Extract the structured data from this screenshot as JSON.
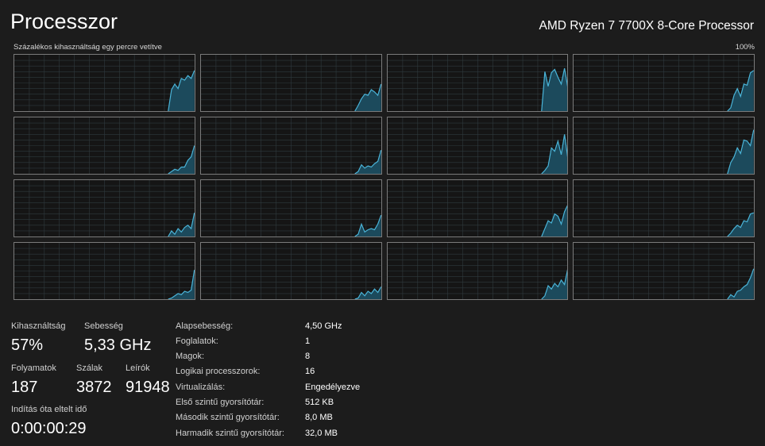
{
  "header": {
    "title": "Processzor",
    "cpu_name": "AMD Ryzen 7 7700X 8-Core Processor"
  },
  "graph": {
    "subtitle": "Százalékos kihasználtság egy percre vetítve",
    "max_label": "100%",
    "line_color": "#4ab4d8",
    "fill_color": "#1c4a5c",
    "grid_color": "#2f3a3e",
    "cores": [
      [
        0,
        0,
        0,
        0,
        0,
        0,
        0,
        0,
        0,
        0,
        0,
        0,
        0,
        0,
        0,
        0,
        0,
        0,
        0,
        0,
        0,
        0,
        0,
        0,
        0,
        0,
        0,
        0,
        0,
        0,
        0,
        0,
        0,
        0,
        0,
        0,
        0,
        0,
        0,
        0,
        0,
        0,
        0,
        0,
        0,
        0,
        0,
        0,
        38,
        48,
        40,
        58,
        55,
        63,
        58,
        72
      ],
      [
        0,
        0,
        0,
        0,
        0,
        0,
        0,
        0,
        0,
        0,
        0,
        0,
        0,
        0,
        0,
        0,
        0,
        0,
        0,
        0,
        0,
        0,
        0,
        0,
        0,
        0,
        0,
        0,
        0,
        0,
        0,
        0,
        0,
        0,
        0,
        0,
        0,
        0,
        0,
        0,
        0,
        0,
        0,
        0,
        0,
        0,
        0,
        0,
        10,
        22,
        30,
        28,
        38,
        34,
        28,
        48
      ],
      [
        0,
        0,
        0,
        0,
        0,
        0,
        0,
        0,
        0,
        0,
        0,
        0,
        0,
        0,
        0,
        0,
        0,
        0,
        0,
        0,
        0,
        0,
        0,
        0,
        0,
        0,
        0,
        0,
        0,
        0,
        0,
        0,
        0,
        0,
        0,
        0,
        0,
        0,
        0,
        0,
        0,
        0,
        0,
        0,
        0,
        0,
        0,
        0,
        70,
        44,
        68,
        74,
        60,
        48,
        76,
        42
      ],
      [
        0,
        0,
        0,
        0,
        0,
        0,
        0,
        0,
        0,
        0,
        0,
        0,
        0,
        0,
        0,
        0,
        0,
        0,
        0,
        0,
        0,
        0,
        0,
        0,
        0,
        0,
        0,
        0,
        0,
        0,
        0,
        0,
        0,
        0,
        0,
        0,
        0,
        0,
        0,
        0,
        0,
        0,
        0,
        0,
        0,
        0,
        0,
        0,
        6,
        28,
        40,
        26,
        48,
        46,
        68,
        72
      ],
      [
        0,
        0,
        0,
        0,
        0,
        0,
        0,
        0,
        0,
        0,
        0,
        0,
        0,
        0,
        0,
        0,
        0,
        0,
        0,
        0,
        0,
        0,
        0,
        0,
        0,
        0,
        0,
        0,
        0,
        0,
        0,
        0,
        0,
        0,
        0,
        0,
        0,
        0,
        0,
        0,
        0,
        0,
        0,
        0,
        0,
        0,
        0,
        0,
        4,
        8,
        6,
        12,
        12,
        24,
        30,
        50
      ],
      [
        0,
        0,
        0,
        0,
        0,
        0,
        0,
        0,
        0,
        0,
        0,
        0,
        0,
        0,
        0,
        0,
        0,
        0,
        0,
        0,
        0,
        0,
        0,
        0,
        0,
        0,
        0,
        0,
        0,
        0,
        0,
        0,
        0,
        0,
        0,
        0,
        0,
        0,
        0,
        0,
        0,
        0,
        0,
        0,
        0,
        0,
        0,
        0,
        4,
        16,
        10,
        14,
        12,
        18,
        22,
        42
      ],
      [
        0,
        0,
        0,
        0,
        0,
        0,
        0,
        0,
        0,
        0,
        0,
        0,
        0,
        0,
        0,
        0,
        0,
        0,
        0,
        0,
        0,
        0,
        0,
        0,
        0,
        0,
        0,
        0,
        0,
        0,
        0,
        0,
        0,
        0,
        0,
        0,
        0,
        0,
        0,
        0,
        0,
        0,
        0,
        0,
        0,
        0,
        0,
        0,
        6,
        14,
        46,
        40,
        58,
        34,
        70,
        28
      ],
      [
        0,
        0,
        0,
        0,
        0,
        0,
        0,
        0,
        0,
        0,
        0,
        0,
        0,
        0,
        0,
        0,
        0,
        0,
        0,
        0,
        0,
        0,
        0,
        0,
        0,
        0,
        0,
        0,
        0,
        0,
        0,
        0,
        0,
        0,
        0,
        0,
        0,
        0,
        0,
        0,
        0,
        0,
        0,
        0,
        0,
        0,
        0,
        0,
        20,
        30,
        46,
        36,
        60,
        58,
        50,
        78
      ],
      [
        0,
        0,
        0,
        0,
        0,
        0,
        0,
        0,
        0,
        0,
        0,
        0,
        0,
        0,
        0,
        0,
        0,
        0,
        0,
        0,
        0,
        0,
        0,
        0,
        0,
        0,
        0,
        0,
        0,
        0,
        0,
        0,
        0,
        0,
        0,
        0,
        0,
        0,
        0,
        0,
        0,
        0,
        0,
        0,
        0,
        0,
        0,
        0,
        10,
        4,
        14,
        8,
        16,
        20,
        14,
        42
      ],
      [
        0,
        0,
        0,
        0,
        0,
        0,
        0,
        0,
        0,
        0,
        0,
        0,
        0,
        0,
        0,
        0,
        0,
        0,
        0,
        0,
        0,
        0,
        0,
        0,
        0,
        0,
        0,
        0,
        0,
        0,
        0,
        0,
        0,
        0,
        0,
        0,
        0,
        0,
        0,
        0,
        0,
        0,
        0,
        0,
        0,
        0,
        0,
        0,
        4,
        22,
        8,
        12,
        14,
        12,
        22,
        38
      ],
      [
        0,
        0,
        0,
        0,
        0,
        0,
        0,
        0,
        0,
        0,
        0,
        0,
        0,
        0,
        0,
        0,
        0,
        0,
        0,
        0,
        0,
        0,
        0,
        0,
        0,
        0,
        0,
        0,
        0,
        0,
        0,
        0,
        0,
        0,
        0,
        0,
        0,
        0,
        0,
        0,
        0,
        0,
        0,
        0,
        0,
        0,
        0,
        0,
        14,
        28,
        24,
        40,
        36,
        22,
        44,
        56
      ],
      [
        0,
        0,
        0,
        0,
        0,
        0,
        0,
        0,
        0,
        0,
        0,
        0,
        0,
        0,
        0,
        0,
        0,
        0,
        0,
        0,
        0,
        0,
        0,
        0,
        0,
        0,
        0,
        0,
        0,
        0,
        0,
        0,
        0,
        0,
        0,
        0,
        0,
        0,
        0,
        0,
        0,
        0,
        0,
        0,
        0,
        0,
        0,
        0,
        6,
        14,
        20,
        16,
        28,
        26,
        40,
        42
      ],
      [
        0,
        0,
        0,
        0,
        0,
        0,
        0,
        0,
        0,
        0,
        0,
        0,
        0,
        0,
        0,
        0,
        0,
        0,
        0,
        0,
        0,
        0,
        0,
        0,
        0,
        0,
        0,
        0,
        0,
        0,
        0,
        0,
        0,
        0,
        0,
        0,
        0,
        0,
        0,
        0,
        0,
        0,
        0,
        0,
        0,
        0,
        0,
        0,
        2,
        6,
        10,
        8,
        14,
        12,
        16,
        52
      ],
      [
        0,
        0,
        0,
        0,
        0,
        0,
        0,
        0,
        0,
        0,
        0,
        0,
        0,
        0,
        0,
        0,
        0,
        0,
        0,
        0,
        0,
        0,
        0,
        0,
        0,
        0,
        0,
        0,
        0,
        0,
        0,
        0,
        0,
        0,
        0,
        0,
        0,
        0,
        0,
        0,
        0,
        0,
        0,
        0,
        0,
        0,
        0,
        0,
        2,
        12,
        6,
        14,
        10,
        18,
        12,
        22
      ],
      [
        0,
        0,
        0,
        0,
        0,
        0,
        0,
        0,
        0,
        0,
        0,
        0,
        0,
        0,
        0,
        0,
        0,
        0,
        0,
        0,
        0,
        0,
        0,
        0,
        0,
        0,
        0,
        0,
        0,
        0,
        0,
        0,
        0,
        0,
        0,
        0,
        0,
        0,
        0,
        0,
        0,
        0,
        0,
        0,
        0,
        0,
        0,
        0,
        6,
        24,
        18,
        28,
        22,
        34,
        26,
        54
      ],
      [
        0,
        0,
        0,
        0,
        0,
        0,
        0,
        0,
        0,
        0,
        0,
        0,
        0,
        0,
        0,
        0,
        0,
        0,
        0,
        0,
        0,
        0,
        0,
        0,
        0,
        0,
        0,
        0,
        0,
        0,
        0,
        0,
        0,
        0,
        0,
        0,
        0,
        0,
        0,
        0,
        0,
        0,
        0,
        0,
        0,
        0,
        0,
        0,
        8,
        4,
        14,
        16,
        22,
        26,
        38,
        54
      ]
    ]
  },
  "stats": {
    "utilization_label": "Kihasználtság",
    "utilization_value": "57%",
    "speed_label": "Sebesség",
    "speed_value": "5,33 GHz",
    "processes_label": "Folyamatok",
    "processes_value": "187",
    "threads_label": "Szálak",
    "threads_value": "3872",
    "handles_label": "Leírók",
    "handles_value": "91948",
    "uptime_label": "Indítás óta eltelt idő",
    "uptime_value": "0:00:00:29"
  },
  "info": [
    {
      "key": "Alapsebesség:",
      "value": "4,50 GHz"
    },
    {
      "key": "Foglalatok:",
      "value": "1"
    },
    {
      "key": "Magok:",
      "value": "8"
    },
    {
      "key": "Logikai processzorok:",
      "value": "16"
    },
    {
      "key": "Virtualizálás:",
      "value": "Engedélyezve"
    },
    {
      "key": "Első szintű gyorsítótár:",
      "value": "512 KB"
    },
    {
      "key": "Második szintű gyorsítótár:",
      "value": "8,0 MB"
    },
    {
      "key": "Harmadik szintű gyorsítótár:",
      "value": "32,0 MB"
    }
  ]
}
